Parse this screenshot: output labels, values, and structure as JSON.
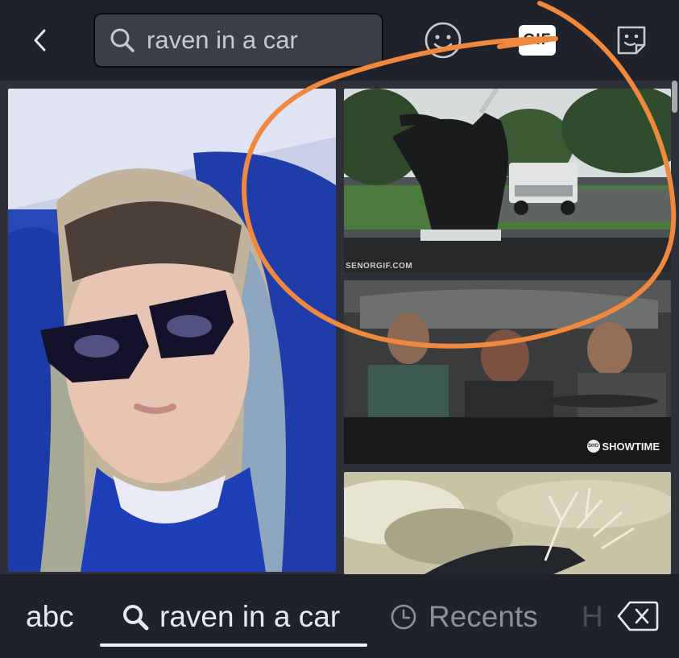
{
  "header": {
    "search": {
      "value": "raven in a car",
      "placeholder": ""
    },
    "gif_label": "GIF",
    "icons": [
      "back-arrow-icon",
      "search-icon",
      "emoji-icon",
      "gif-icon",
      "sticker-icon"
    ]
  },
  "results": {
    "tiles": [
      {
        "name": "gif-result-woman-sunglasses",
        "watermark": ""
      },
      {
        "name": "gif-result-raven-windshield",
        "watermark": "SENORGIF.COM"
      },
      {
        "name": "gif-result-people-in-car",
        "watermark": "SHOWTIME"
      },
      {
        "name": "gif-result-raven-branches",
        "watermark": ""
      }
    ]
  },
  "annotation": {
    "color": "#f0883e"
  },
  "bottom": {
    "tab_abc": "abc",
    "tab_search": "raven in a car",
    "tab_recents": "Recents",
    "tab_partial": "H",
    "icons": [
      "search-icon",
      "clock-icon",
      "backspace-icon"
    ]
  },
  "colors": {
    "bar_bg": "#1f222b",
    "grid_bg": "#2d3038",
    "search_bg": "#3b3e48",
    "text": "#e8e9ec",
    "dim_text": "#8c8f97"
  }
}
